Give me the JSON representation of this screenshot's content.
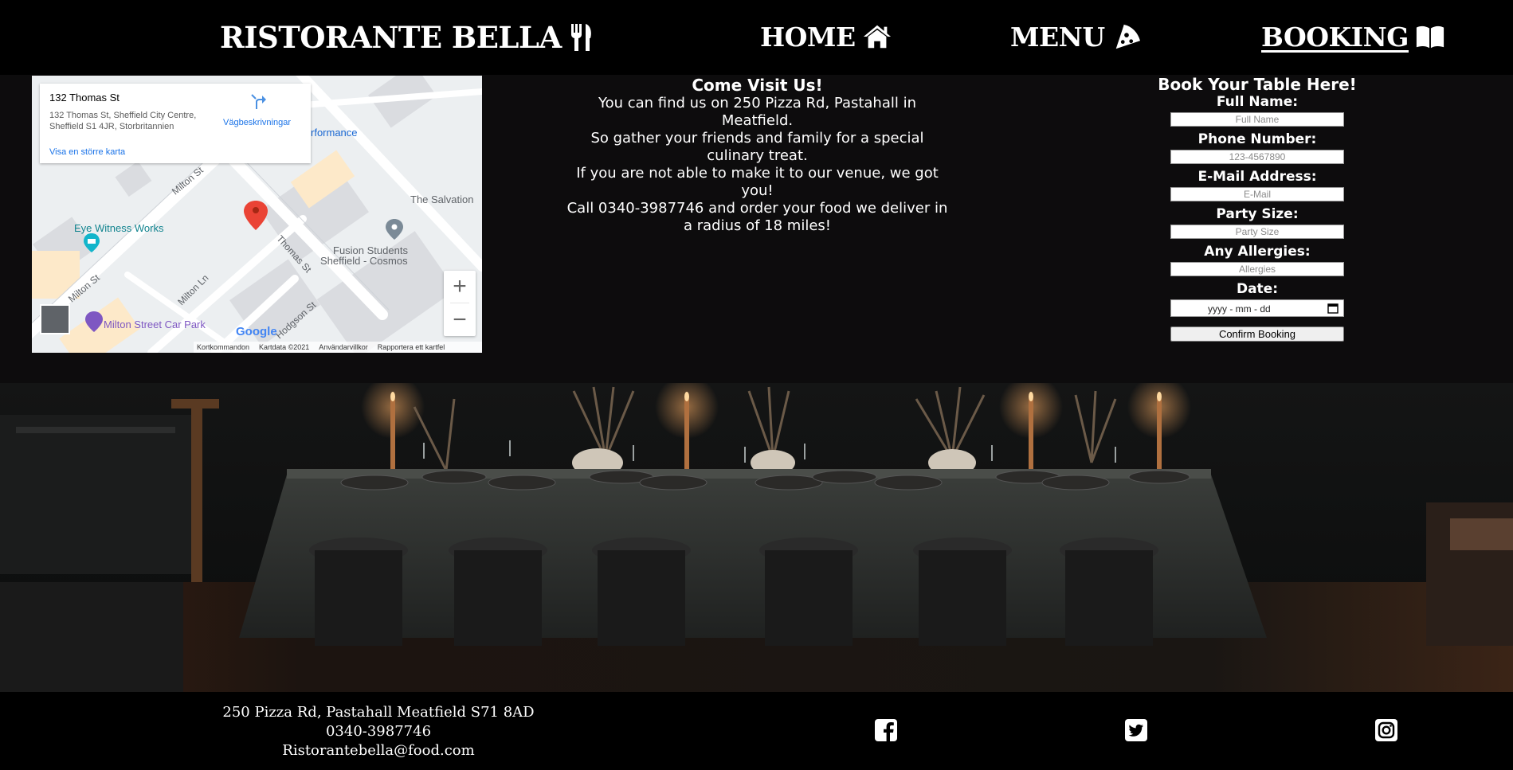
{
  "nav": {
    "brand": "RISTORANTE BELLA",
    "brand_icon": "utensils-icon",
    "links": [
      {
        "label": "HOME",
        "icon": "house-icon"
      },
      {
        "label": "MENU",
        "icon": "pizza-slice-icon"
      },
      {
        "label": "BOOKING",
        "icon": "open-book-icon",
        "active": true
      }
    ]
  },
  "map": {
    "place_name": "132 Thomas St",
    "address": "132 Thomas St, Sheffield City Centre, Sheffield S1 4JR, Storbritannien",
    "larger_map": "Visa en större karta",
    "directions": "Vägbeskrivningar",
    "labels": {
      "performance": "rformance",
      "milton_st_1": "Milton St",
      "milton_st_2": "Milton St",
      "milton_ln": "Milton Ln",
      "thomas_st": "Thomas St",
      "hodgson_st": "Hodgson St",
      "eye_witness": "Eye Witness Works",
      "salvation": "The Salvation",
      "fusion_1": "Fusion Students",
      "fusion_2": "Sheffield - Cosmos",
      "car_park": "Milton Street Car Park",
      "google": "Google"
    },
    "footer": {
      "shortcuts": "Kortkommandon",
      "mapdata": "Kartdata ©2021",
      "terms": "Användarvillkor",
      "report": "Rapportera ett kartfel"
    },
    "zoom_in": "+",
    "zoom_out": "−"
  },
  "visit": {
    "title": "Come Visit Us!",
    "line1": "You can find us on 250 Pizza Rd, Pastahall in Meatfield.",
    "line2": "So gather your friends and family for a special culinary treat.",
    "line3": "If you are not able to make it to our venue, we got you!",
    "line4": "Call 0340-3987746 and order your food we deliver in a radius of 18 miles!"
  },
  "booking": {
    "title": "Book Your Table Here!",
    "full_name_label": "Full Name:",
    "full_name_placeholder": "Full Name",
    "phone_label": "Phone Number:",
    "phone_placeholder": "123-4567890",
    "email_label": "E-Mail Address:",
    "email_placeholder": "E-Mail",
    "party_label": "Party Size:",
    "party_placeholder": "Party Size",
    "allergies_label": "Any Allergies:",
    "allergies_placeholder": "Allergies",
    "date_label": "Date:",
    "date_placeholder": "yyyy - mm - dd",
    "confirm_button": "Confirm Booking"
  },
  "footer": {
    "address": "250 Pizza Rd, Pastahall Meatfield S71 8AD",
    "phone": "0340-3987746",
    "email": "Ristorantebella@food.com",
    "social": [
      "facebook-icon",
      "twitter-icon",
      "instagram-icon"
    ]
  },
  "colors": {
    "page_bg": "#0d0c0d",
    "nav_bg": "#000000",
    "text": "#ffffff",
    "map_link": "#1a73e8",
    "map_pin": "#ea4335"
  }
}
